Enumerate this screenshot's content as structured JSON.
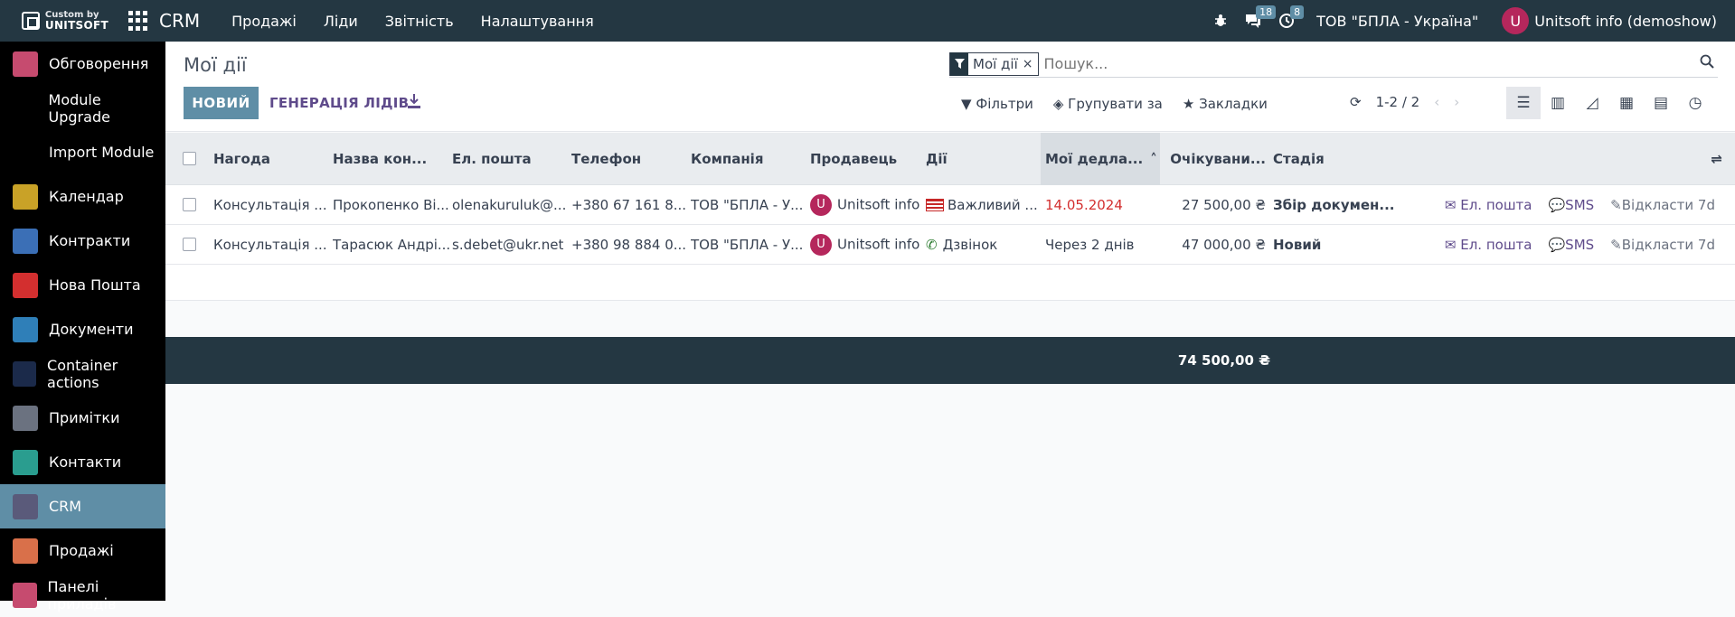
{
  "topbar": {
    "brand_small": "Custom by",
    "brand_big": "UNITSOFT",
    "app_name": "CRM",
    "menu": [
      "Продажі",
      "Ліди",
      "Звітність",
      "Налаштування"
    ],
    "messages_count": "18",
    "activities_count": "8",
    "company": "ТОВ \"БПЛА - Україна\"",
    "user_initial": "U",
    "user_name": "Unitsoft info (demoshow)"
  },
  "sidebar": {
    "items": [
      {
        "label": "Обговорення",
        "icon": "chat-icon",
        "color": "#c64b6f",
        "active": false
      },
      {
        "label": "Module Upgrade",
        "icon": "",
        "color": "",
        "active": false
      },
      {
        "label": "Import Module",
        "icon": "",
        "color": "",
        "active": false
      },
      {
        "label": "Календар",
        "icon": "calendar-icon",
        "color": "#c9a227",
        "active": false
      },
      {
        "label": "Контракти",
        "icon": "contract-icon",
        "color": "#3b6fb6",
        "active": false
      },
      {
        "label": "Нова Пошта",
        "icon": "novaposhta-icon",
        "color": "#d32f2f",
        "active": false
      },
      {
        "label": "Документи",
        "icon": "documents-icon",
        "color": "#2f7fb8",
        "active": false
      },
      {
        "label": "Container actions",
        "icon": "container-icon",
        "color": "#1b2a4a",
        "active": false
      },
      {
        "label": "Примітки",
        "icon": "notes-icon",
        "color": "#6b7280",
        "active": false
      },
      {
        "label": "Контакти",
        "icon": "contacts-icon",
        "color": "#2a9d8f",
        "active": false
      },
      {
        "label": "CRM",
        "icon": "crm-icon",
        "color": "#5a5a7a",
        "active": true
      },
      {
        "label": "Продажі",
        "icon": "sales-icon",
        "color": "#d9704a",
        "active": false
      },
      {
        "label": "Панелі приладів",
        "icon": "dashboard-icon",
        "color": "#c64b6f",
        "active": false
      }
    ]
  },
  "control_panel": {
    "title": "Мої дії",
    "new_label": "НОВИЙ",
    "generate_label": "ГЕНЕРАЦІЯ ЛІДІВ",
    "facet_label": "Мої дії",
    "search_placeholder": "Пошук...",
    "filters_label": "Фільтри",
    "groupby_label": "Групувати за",
    "favorites_label": "Закладки",
    "pager_value": "1-2 / 2"
  },
  "table": {
    "headers": [
      "Нагода",
      "Назва кон...",
      "Ел. пошта",
      "Телефон",
      "Компанія",
      "Продавець",
      "Дії",
      "Мої дедла...",
      "Очікувани...",
      "Стадія"
    ],
    "rows": [
      {
        "opportunity": "Консультація ...",
        "contact": "Прокопенко Ві...",
        "email": "olenakuruluk@...",
        "phone": "+380 67 161 8...",
        "company": "ТОВ \"БПЛА - У...",
        "salesperson": "Unitsoft info",
        "activity": "Важливий ...",
        "deadline": "14.05.2024",
        "expected": "27 500,00 ₴",
        "stage": "Збір докумен...",
        "action_email": "Ел. пошта",
        "action_sms": "SMS",
        "action_snooze": "Відкласти 7d"
      },
      {
        "opportunity": "Консультація ...",
        "contact": "Тарасюк Андрі...",
        "email": "s.debet@ukr.net",
        "phone": "+380 98 884 0...",
        "company": "ТОВ \"БПЛА - У...",
        "salesperson": "Unitsoft info",
        "activity": "Дзвінок",
        "deadline": "Через 2 днів",
        "expected": "47 000,00 ₴",
        "stage": "Новий",
        "action_email": "Ел. пошта",
        "action_sms": "SMS",
        "action_snooze": "Відкласти 7d"
      }
    ],
    "total_expected": "74 500,00 ₴"
  }
}
